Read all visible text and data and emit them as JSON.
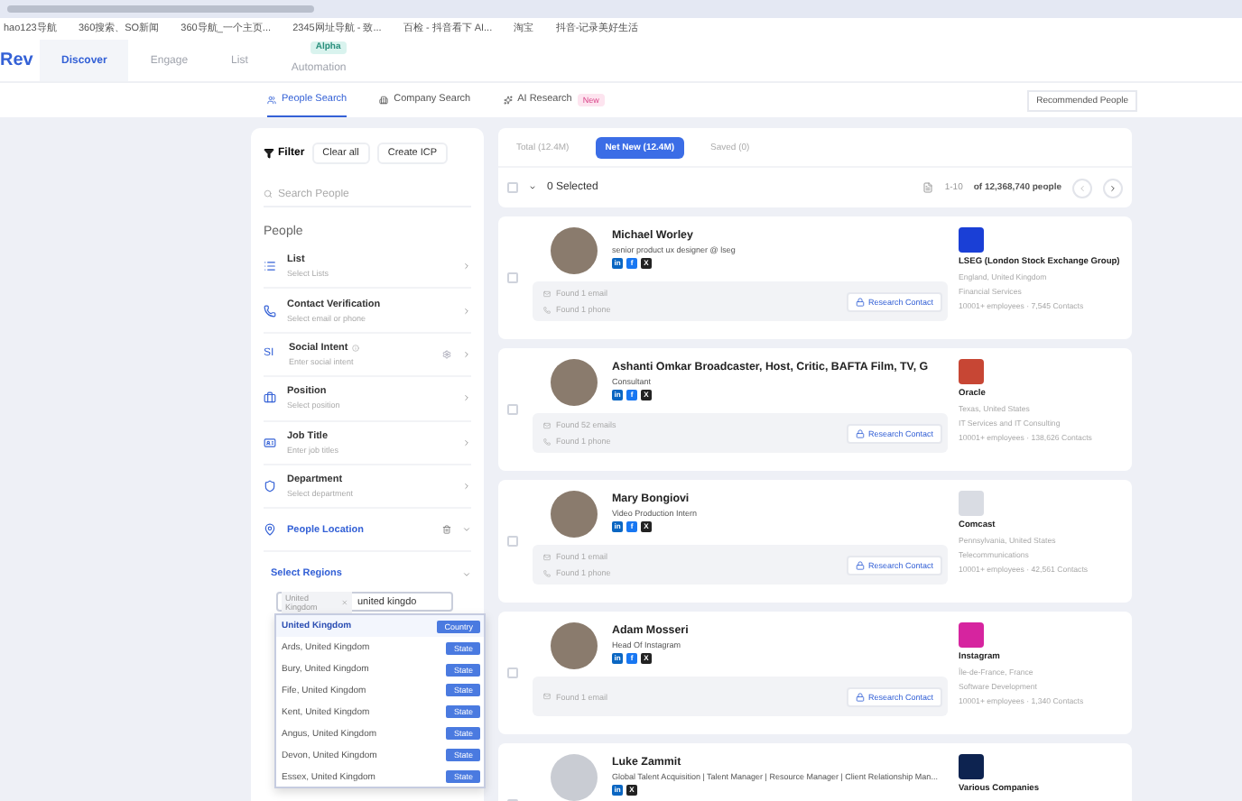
{
  "bookmarks": [
    "hao123导航",
    "360搜索、SO新闻",
    "360导航_一个主页...",
    "2345网址导航 - 致...",
    "百检 - 抖音看下 AI...",
    "淘宝",
    "抖音-记录美好生活"
  ],
  "app": {
    "logo": "Rev",
    "tabs": [
      {
        "label": "Discover",
        "selected": true
      },
      {
        "label": "Engage",
        "selected": false
      },
      {
        "label": "List",
        "selected": false
      },
      {
        "label": "Automation",
        "selected": false,
        "badge": "Alpha"
      }
    ]
  },
  "subtabs": [
    {
      "label": "People Search",
      "selected": true
    },
    {
      "label": "Company Search",
      "selected": false
    },
    {
      "label": "AI Research",
      "selected": false,
      "badge": "New"
    }
  ],
  "recommended_button": "Recommended People",
  "filter": {
    "title": "Filter",
    "clear": "Clear all",
    "create": "Create ICP",
    "search_placeholder": "Search People",
    "section": "People",
    "items": [
      {
        "label": "List",
        "hint": "Select Lists"
      },
      {
        "label": "Contact Verification",
        "hint": "Select email or phone"
      },
      {
        "label": "Social Intent",
        "hint": "Enter social intent",
        "icon_text": "SI"
      },
      {
        "label": "Position",
        "hint": "Select position"
      },
      {
        "label": "Job Title",
        "hint": "Enter job titles"
      },
      {
        "label": "Department",
        "hint": "Select department"
      }
    ],
    "location": {
      "label": "People Location",
      "expanded": true,
      "regions_label": "Select Regions",
      "chip": "United Kingdom",
      "value": "united kingdo",
      "options": [
        {
          "label": "United Kingdom",
          "tag": "Country",
          "selected": true
        },
        {
          "label": "Ards, United Kingdom",
          "tag": "State",
          "selected": false
        },
        {
          "label": "Bury, United Kingdom",
          "tag": "State",
          "selected": false
        },
        {
          "label": "Fife, United Kingdom",
          "tag": "State",
          "selected": false
        },
        {
          "label": "Kent, United Kingdom",
          "tag": "State",
          "selected": false
        },
        {
          "label": "Angus, United Kingdom",
          "tag": "State",
          "selected": false
        },
        {
          "label": "Devon, United Kingdom",
          "tag": "State",
          "selected": false
        },
        {
          "label": "Essex, United Kingdom",
          "tag": "State",
          "selected": false
        }
      ]
    }
  },
  "results": {
    "tabs": [
      {
        "label": "Total (12.4M)",
        "selected": false
      },
      {
        "label": "Net New (12.4M)",
        "selected": true
      },
      {
        "label": "Saved (0)",
        "selected": false
      }
    ],
    "select_all_checked": false,
    "selected_count": "0 Selected",
    "range": "1-10",
    "total": "of 12,368,740 people",
    "people": [
      {
        "name": "Michael Worley",
        "checked": false,
        "title": "senior product ux designer @ lseg",
        "socials": [
          "in",
          "f",
          "X"
        ],
        "contacts": [
          {
            "kind": "email",
            "text": "Found 1 email"
          },
          {
            "kind": "phone",
            "text": "Found 1 phone"
          }
        ],
        "action": "Research Contact",
        "company": {
          "name": "LSEG (London Stock Exchange Group)",
          "color": "#1a3fd6",
          "details": [
            "England, United Kingdom",
            "Financial Services",
            "10001+ employees · 7,545 Contacts"
          ]
        }
      },
      {
        "name": "Ashanti Omkar Broadcaster, Host, Critic, BAFTA Film, TV, G",
        "checked": false,
        "title": "Consultant",
        "socials": [
          "in",
          "f",
          "X"
        ],
        "contacts": [
          {
            "kind": "email",
            "text": "Found 52 emails"
          },
          {
            "kind": "phone",
            "text": "Found 1 phone"
          }
        ],
        "action": "Research Contact",
        "company": {
          "name": "Oracle",
          "color": "#c74634",
          "details": [
            "Texas, United States",
            "IT Services and IT Consulting",
            "10001+ employees · 138,626 Contacts"
          ]
        }
      },
      {
        "name": "Mary Bongiovi",
        "checked": false,
        "title": "Video Production Intern",
        "socials": [
          "in",
          "f",
          "X"
        ],
        "contacts": [
          {
            "kind": "email",
            "text": "Found 1 email"
          },
          {
            "kind": "phone",
            "text": "Found 1 phone"
          }
        ],
        "action": "Research Contact",
        "company": {
          "name": "Comcast",
          "color": "#d9dce3",
          "details": [
            "Pennsylvania, United States",
            "Telecommunications",
            "10001+ employees · 42,561 Contacts"
          ]
        }
      },
      {
        "name": "Adam Mosseri",
        "checked": false,
        "title": "Head Of Instagram",
        "socials": [
          "in",
          "f",
          "X"
        ],
        "contacts": [
          {
            "kind": "email",
            "text": "Found 1 email"
          }
        ],
        "action": "Research Contact",
        "company": {
          "name": "Instagram",
          "color": "#d6249f",
          "details": [
            "Île-de-France, France",
            "Software Development",
            "10001+ employees · 1,340 Contacts"
          ]
        }
      },
      {
        "name": "Luke Zammit",
        "checked": false,
        "title": "Global Talent Acquisition | Talent Manager | Resource Manager | Client Relationship Man...",
        "socials": [
          "in",
          "X"
        ],
        "company": {
          "name": "Various Companies",
          "color": "#0d2350"
        }
      }
    ]
  }
}
